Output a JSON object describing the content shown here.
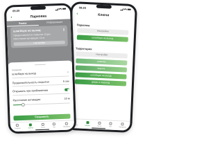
{
  "phone1": {
    "status_time": "09:20",
    "title": "Парковка",
    "tabs": [
      "Замки",
      "Информация"
    ],
    "card": {
      "title": "шлагбаум на выход",
      "line1": "Предоставляется открытие: 8 ден",
      "line2": "Расстояние активации: 10 м",
      "button": "Настройки"
    },
    "sheet": {
      "name_label": "Название",
      "name_value": "шлагбаум на выход",
      "duration_label": "Продолжительность открытия",
      "duration_value": "5 сек",
      "approach_label": "Открывать при приближении",
      "approach_on": true,
      "distance_label": "Расстояние активации",
      "distance_value": "10 м",
      "slider_fraction": 0.18,
      "save": "Сохранить"
    },
    "tabbar": [
      "Главная",
      "Ключи",
      "Гости",
      "Чат",
      "Профиль"
    ],
    "tabbar_active": 1
  },
  "phone2": {
    "status_time": "09:20",
    "title": "Ключи",
    "sections": [
      {
        "title": "Парковка",
        "buttons": [
          {
            "label": "Настройки",
            "style": "pale"
          },
          {
            "label": "шлагбаум на выход",
            "style": "green"
          }
        ]
      },
      {
        "title": "Территория",
        "buttons": [
          {
            "label": "Настройки",
            "style": "pale"
          },
          {
            "label": "калитка",
            "style": "light"
          },
          {
            "label": "ворота",
            "style": "mid"
          },
          {
            "label": "шлагбаум на въезд",
            "style": "green"
          },
          {
            "label": "дверь в подъезд",
            "style": "green"
          }
        ]
      }
    ],
    "tabbar": [
      "Главная",
      "Ключи",
      "Гости",
      "Чат",
      "Профиль"
    ],
    "tabbar_active": 1
  },
  "colors": {
    "accent": "#2e8b3d",
    "accent_light": "#7cc26a",
    "overlay": "#8a8b8d"
  }
}
